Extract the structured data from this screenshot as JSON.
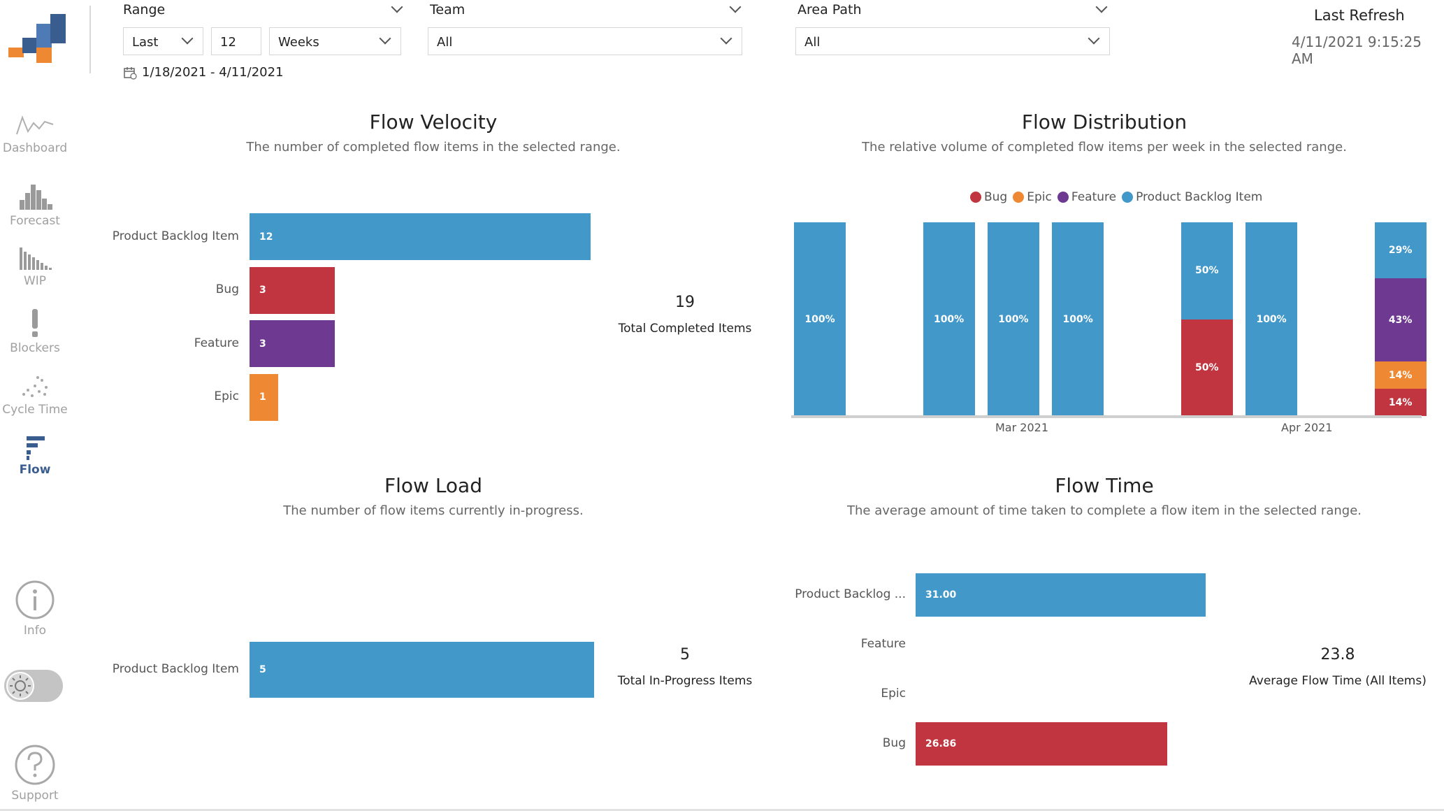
{
  "sidebar": {
    "items": [
      {
        "label": "Dashboard",
        "icon": "dashboard-line-icon"
      },
      {
        "label": "Forecast",
        "icon": "forecast-bars-icon"
      },
      {
        "label": "WIP",
        "icon": "wip-bars-icon"
      },
      {
        "label": "Blockers",
        "icon": "exclamation-icon"
      },
      {
        "label": "Cycle Time",
        "icon": "scatter-icon"
      },
      {
        "label": "Flow",
        "icon": "flow-bars-icon"
      }
    ],
    "info_label": "Info",
    "support_label": "Support"
  },
  "filters": {
    "range": {
      "label": "Range",
      "mode": "Last",
      "count": "12",
      "unit": "Weeks",
      "dates": "1/18/2021 - 4/11/2021"
    },
    "team": {
      "label": "Team",
      "value": "All"
    },
    "area_path": {
      "label": "Area Path",
      "value": "All"
    }
  },
  "refresh": {
    "label": "Last Refresh",
    "time": "4/11/2021 9:15:25 AM"
  },
  "colors": {
    "pbi": "#4298c9",
    "bug": "#c0353f",
    "feature": "#6e3a91",
    "epic": "#ef8833",
    "accent": "#3a5d8f"
  },
  "velocity": {
    "title": "Flow Velocity",
    "subtitle": "The number of completed flow items in the selected range.",
    "kpi_value": "19",
    "kpi_label": "Total Completed Items"
  },
  "distribution": {
    "title": "Flow Distribution",
    "subtitle": "The relative volume of completed flow items per week in the selected range.",
    "legend": [
      "Bug",
      "Epic",
      "Feature",
      "Product Backlog Item"
    ],
    "xticks": [
      "Mar 2021",
      "Apr 2021"
    ]
  },
  "load": {
    "title": "Flow Load",
    "subtitle": "The number of flow items currently in-progress.",
    "kpi_value": "5",
    "kpi_label": "Total In-Progress Items"
  },
  "time": {
    "title": "Flow Time",
    "subtitle": "The average amount of time taken to complete a flow item in the selected range.",
    "kpi_value": "23.8",
    "kpi_label": "Average Flow Time (All Items)"
  },
  "chart_data": [
    {
      "type": "bar",
      "title": "Flow Velocity",
      "categories": [
        "Product Backlog Item",
        "Bug",
        "Feature",
        "Epic"
      ],
      "values": [
        12,
        3,
        3,
        1
      ],
      "labels": [
        "12",
        "3",
        "3",
        "1"
      ]
    },
    {
      "type": "bar",
      "title": "Flow Distribution",
      "stacked": true,
      "columns": [
        {
          "segments": [
            {
              "series": "Product Backlog Item",
              "value": 100,
              "label": "100%"
            }
          ]
        },
        {
          "segments": []
        },
        {
          "segments": [
            {
              "series": "Product Backlog Item",
              "value": 100,
              "label": "100%"
            }
          ]
        },
        {
          "segments": [
            {
              "series": "Product Backlog Item",
              "value": 100,
              "label": "100%"
            }
          ]
        },
        {
          "segments": [
            {
              "series": "Product Backlog Item",
              "value": 100,
              "label": "100%"
            }
          ]
        },
        {
          "segments": []
        },
        {
          "segments": [
            {
              "series": "Bug",
              "value": 50,
              "label": "50%"
            },
            {
              "series": "Product Backlog Item",
              "value": 50,
              "label": "50%"
            }
          ]
        },
        {
          "segments": [
            {
              "series": "Product Backlog Item",
              "value": 100,
              "label": "100%"
            }
          ]
        },
        {
          "segments": []
        },
        {
          "segments": [
            {
              "series": "Bug",
              "value": 14,
              "label": "14%"
            },
            {
              "series": "Epic",
              "value": 14,
              "label": "14%"
            },
            {
              "series": "Feature",
              "value": 43,
              "label": "43%"
            },
            {
              "series": "Product Backlog Item",
              "value": 29,
              "label": "29%"
            }
          ]
        }
      ],
      "xticks": [
        "Mar 2021",
        "Apr 2021"
      ]
    },
    {
      "type": "bar",
      "title": "Flow Load",
      "categories": [
        "Product Backlog Item"
      ],
      "values": [
        5
      ],
      "labels": [
        "5"
      ]
    },
    {
      "type": "bar",
      "title": "Flow Time",
      "categories": [
        "Product Backlog ...",
        "Feature",
        "Epic",
        "Bug"
      ],
      "values": [
        31.0,
        0,
        0,
        26.86
      ],
      "labels": [
        "31.00",
        "",
        "",
        "26.86"
      ]
    }
  ]
}
